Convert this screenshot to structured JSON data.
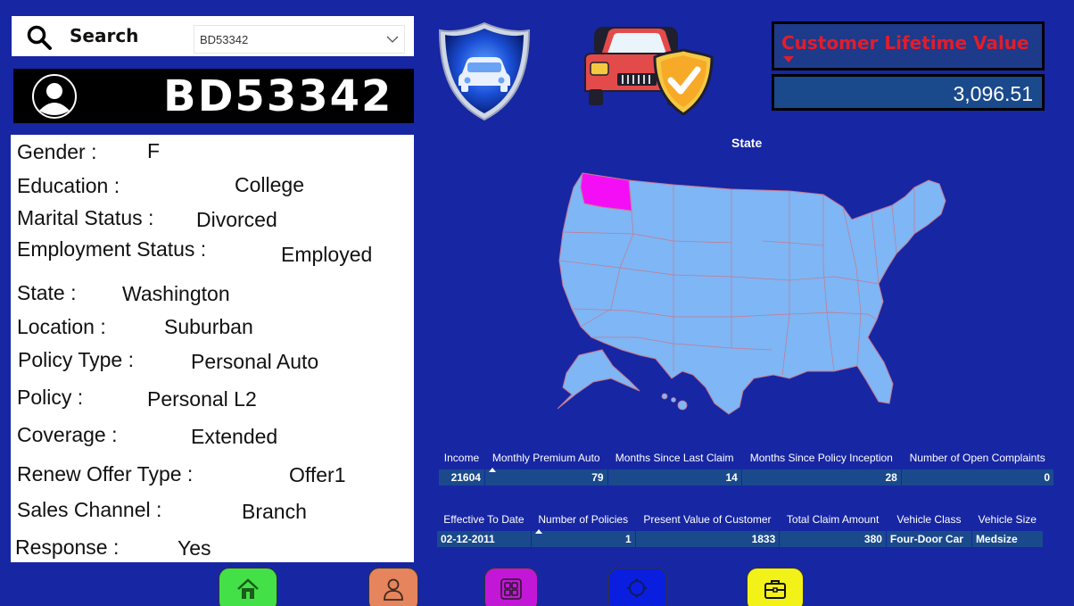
{
  "search": {
    "label": "Search",
    "selected_value": "BD53342"
  },
  "customer": {
    "id": "BD53342",
    "details": [
      {
        "label": "Gender  :",
        "value": "F"
      },
      {
        "label": "Education  :",
        "value": "College"
      },
      {
        "label": "Marital Status  :",
        "value": "Divorced"
      },
      {
        "label": "Employment Status  :",
        "value": "Employed"
      },
      {
        "label": "State  :",
        "value": "Washington"
      },
      {
        "label": "Location :",
        "value": "Suburban"
      },
      {
        "label": "Policy Type  :",
        "value": "Personal Auto"
      },
      {
        "label": "Policy  :",
        "value": "Personal L2"
      },
      {
        "label": "Coverage  :",
        "value": "Extended"
      },
      {
        "label": "Renew Offer Type  :",
        "value": "Offer1"
      },
      {
        "label": "Sales Channel  :",
        "value": "Branch"
      },
      {
        "label": "Response  :",
        "value": "Yes"
      }
    ]
  },
  "clv": {
    "title": "Customer Lifetime Value",
    "value": "3,096.51"
  },
  "map": {
    "title": "State",
    "highlighted_state": "Washington",
    "base_color": "#7fb6f5",
    "highlight_color": "#f30ef6"
  },
  "table1": {
    "headers": [
      "Income",
      "Monthly Premium Auto",
      "Months Since Last Claim",
      "Months Since Policy Inception",
      "Number of Open Complaints"
    ],
    "sorted_column": "Monthly Premium Auto",
    "row": [
      "21604",
      "79",
      "14",
      "28",
      "0"
    ]
  },
  "table2": {
    "headers": [
      "Effective To Date",
      "Number of Policies",
      "Present Value of Customer",
      "Total Claim Amount",
      "Vehicle Class",
      "Vehicle Size"
    ],
    "sorted_column": "Number of Policies",
    "row": [
      "02-12-2011",
      "1",
      "1833",
      "380",
      "Four-Door Car",
      "Medsize"
    ]
  },
  "nav": [
    {
      "name": "home",
      "icon": "home-icon",
      "color": "#44e047"
    },
    {
      "name": "profile",
      "icon": "user-icon",
      "color": "#e5845d"
    },
    {
      "name": "grid",
      "icon": "grid-icon",
      "color": "#c217d6"
    },
    {
      "name": "search",
      "icon": "search-icon",
      "color": "#0a1ee0"
    },
    {
      "name": "briefcase",
      "icon": "briefcase-icon",
      "color": "#f3f218"
    }
  ],
  "colors": {
    "background": "#1726a3",
    "clv_title": "#e11d2b",
    "table_cell": "#1a4a8c"
  }
}
